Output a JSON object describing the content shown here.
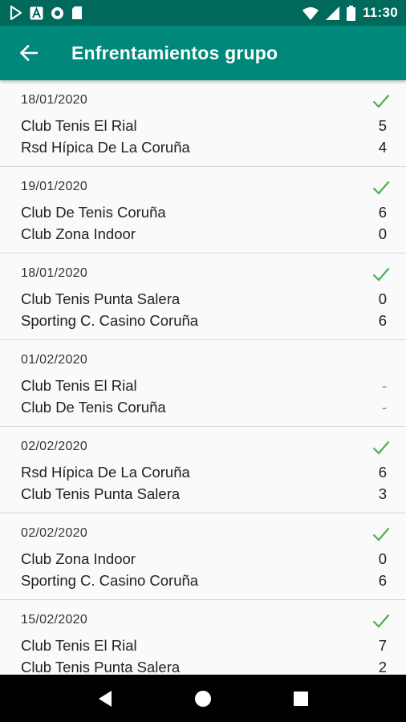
{
  "status_bar": {
    "time": "11:30",
    "icons": [
      "play-store-icon",
      "a-icon",
      "circle-icon",
      "sd-card-icon",
      "wifi-icon",
      "signal-icon",
      "battery-icon"
    ]
  },
  "app_bar": {
    "title": "Enfrentamientos grupo",
    "back_icon": "arrow-back-icon",
    "background": "#00897b",
    "status_background": "#00695c"
  },
  "colors": {
    "check": "#4caf50"
  },
  "matches": [
    {
      "date": "18/01/2020",
      "home": "Club Tenis El Rial",
      "home_score": "5",
      "away": "Rsd Hípica De La Coruña",
      "away_score": "4",
      "played": true
    },
    {
      "date": "19/01/2020",
      "home": "Club De Tenis Coruña",
      "home_score": "6",
      "away": "Club Zona Indoor",
      "away_score": "0",
      "played": true
    },
    {
      "date": "18/01/2020",
      "home": "Club Tenis Punta Salera",
      "home_score": "0",
      "away": "Sporting C. Casino Coruña",
      "away_score": "6",
      "played": true
    },
    {
      "date": "01/02/2020",
      "home": "Club Tenis El Rial",
      "home_score": "-",
      "away": "Club De Tenis Coruña",
      "away_score": "-",
      "played": false
    },
    {
      "date": "02/02/2020",
      "home": "Rsd Hípica De La Coruña",
      "home_score": "6",
      "away": "Club Tenis Punta Salera",
      "away_score": "3",
      "played": true
    },
    {
      "date": "02/02/2020",
      "home": "Club Zona Indoor",
      "home_score": "0",
      "away": "Sporting C. Casino Coruña",
      "away_score": "6",
      "played": true
    },
    {
      "date": "15/02/2020",
      "home": "Club Tenis El Rial",
      "home_score": "7",
      "away": "Club Tenis Punta Salera",
      "away_score": "2",
      "played": true
    }
  ],
  "nav_bar": {
    "buttons": [
      "back-triangle-icon",
      "home-circle-icon",
      "recents-square-icon"
    ]
  }
}
